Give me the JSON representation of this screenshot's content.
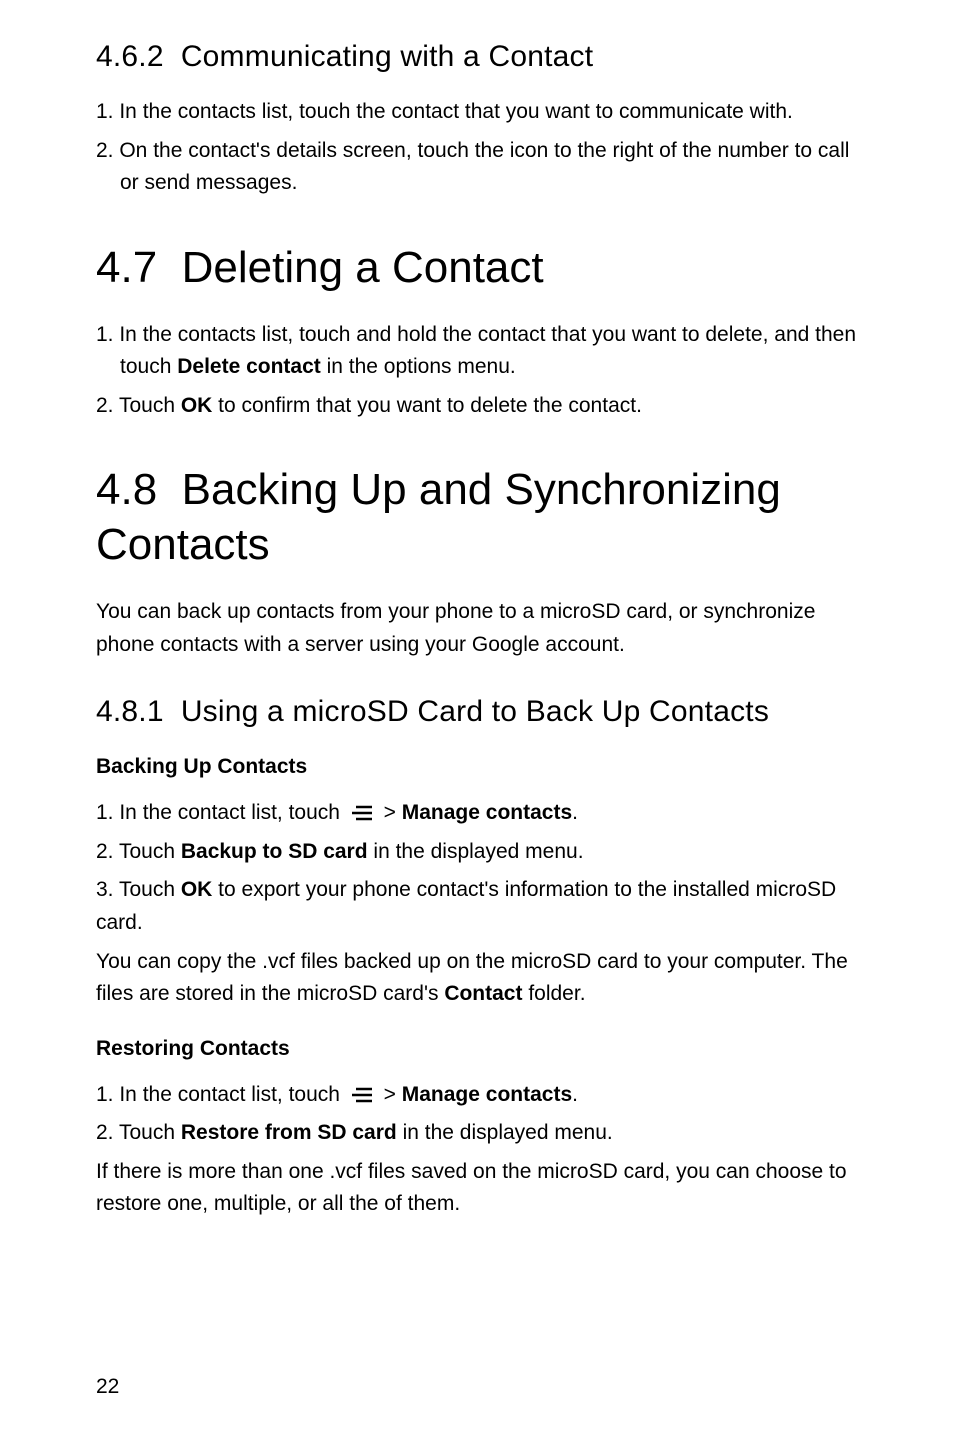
{
  "sec462": {
    "title_num": "4.6.2",
    "title_text": "Communicating with a Contact",
    "step1": "1. In the contacts list, touch the contact that you want to communicate with.",
    "step2": "2. On the contact's details screen, touch the icon to the right of the number to call or send messages."
  },
  "sec47": {
    "title_num": "4.7",
    "title_text": "Deleting a Contact",
    "step1_pre": "1. In the contacts list, touch and hold the contact that you want to delete, and then touch ",
    "step1_bold": "Delete contact",
    "step1_post": " in the options menu.",
    "step2_pre": "2. Touch ",
    "step2_bold": "OK",
    "step2_post": " to confirm that you want to delete the contact."
  },
  "sec48": {
    "title_num": "4.8",
    "title_text": "Backing Up and Synchronizing Contacts",
    "intro": "You can back up contacts from your phone to a microSD card, or synchronize phone contacts with a server using your Google account."
  },
  "sec481": {
    "title_num": "4.8.1",
    "title_text": "Using a microSD Card to Back Up Contacts",
    "backup_heading": "Backing Up Contacts",
    "b_step1_pre": "1. In the contact list, touch ",
    "b_step1_gt": " > ",
    "b_step1_bold": "Manage contacts",
    "b_step1_end": ".",
    "b_step2_pre": "2. Touch ",
    "b_step2_bold": "Backup to SD card",
    "b_step2_post": " in the displayed menu.",
    "b_step3_pre": "3. Touch ",
    "b_step3_bold": "OK",
    "b_step3_post": " to export your phone contact's information to the installed microSD card.",
    "b_note_pre": "You can copy the .vcf files backed up on the microSD card to your computer. The files are stored in the microSD card's ",
    "b_note_bold": "Contact",
    "b_note_post": " folder.",
    "restore_heading": "Restoring Contacts",
    "r_step1_pre": "1. In the contact list, touch ",
    "r_step1_gt": " > ",
    "r_step1_bold": "Manage contacts",
    "r_step1_end": ".",
    "r_step2_pre": "2. Touch ",
    "r_step2_bold": "Restore from SD card",
    "r_step2_post": " in the displayed menu.",
    "r_note": "If there is more than one .vcf files saved on the microSD card, you can choose to restore one, multiple, or all the of them."
  },
  "page_number": "22"
}
